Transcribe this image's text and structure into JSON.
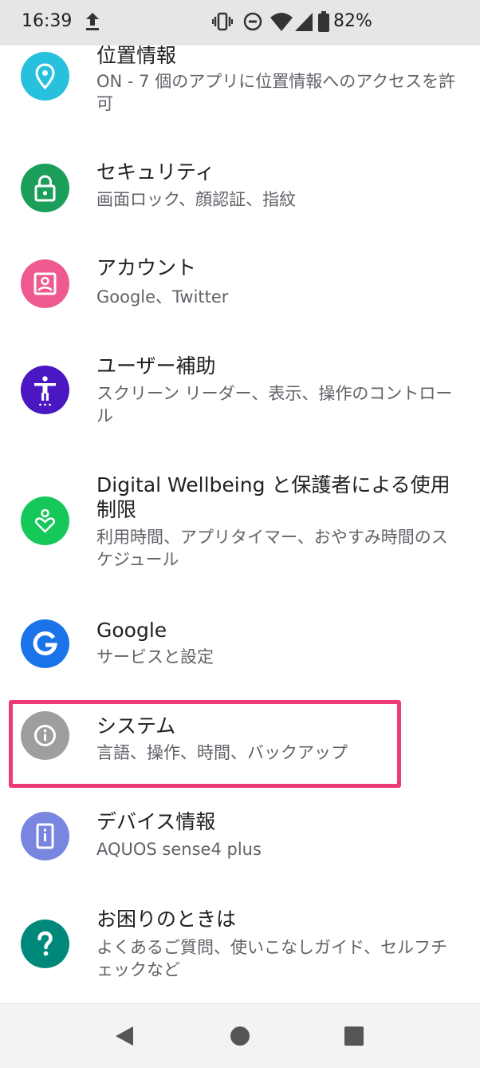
{
  "status_bar": {
    "time": "16:39",
    "battery_percent": "82%",
    "icons": [
      "upload-icon",
      "vibrate-icon",
      "do-not-disturb-icon",
      "wifi-icon",
      "cell-signal-icon",
      "battery-icon"
    ]
  },
  "settings": {
    "items": [
      {
        "id": "location",
        "title": "位置情報",
        "summary": "ON - 7 個のアプリに位置情報へのアクセスを許可",
        "icon": "location-pin-icon",
        "color": "#28c1dd"
      },
      {
        "id": "security",
        "title": "セキュリティ",
        "summary": "画面ロック、顔認証、指紋",
        "icon": "lock-icon",
        "color": "#1a9e5a"
      },
      {
        "id": "accounts",
        "title": "アカウント",
        "summary": "Google、Twitter",
        "icon": "account-box-icon",
        "color": "#ee5a8f"
      },
      {
        "id": "accessibility",
        "title": "ユーザー補助",
        "summary": "スクリーン リーダー、表示、操作のコントロール",
        "icon": "accessibility-icon",
        "color": "#4a17c2"
      },
      {
        "id": "digital-wellbeing",
        "title": "Digital Wellbeing と保護者による使用制限",
        "summary": "利用時間、アプリタイマー、おやすみ時間のスケジュール",
        "icon": "wellbeing-heart-icon",
        "color": "#16c75a"
      },
      {
        "id": "google",
        "title": "Google",
        "summary": "サービスと設定",
        "icon": "google-g-icon",
        "color": "#1a73e8"
      },
      {
        "id": "system",
        "title": "システム",
        "summary": "言語、操作、時間、バックアップ",
        "icon": "info-icon",
        "color": "#9e9e9e"
      },
      {
        "id": "device-info",
        "title": "デバイス情報",
        "summary": "AQUOS sense4 plus",
        "icon": "phone-info-icon",
        "color": "#7986e0"
      },
      {
        "id": "help",
        "title": "お困りのときは",
        "summary": "よくあるご質問、使いこなしガイド、セルフチェックなど",
        "icon": "help-question-icon",
        "color": "#00897b"
      }
    ]
  },
  "highlight": {
    "item": "system",
    "color": "#ee3b73"
  },
  "nav_bar": {
    "buttons": [
      "back-icon",
      "home-icon",
      "recents-icon"
    ]
  }
}
